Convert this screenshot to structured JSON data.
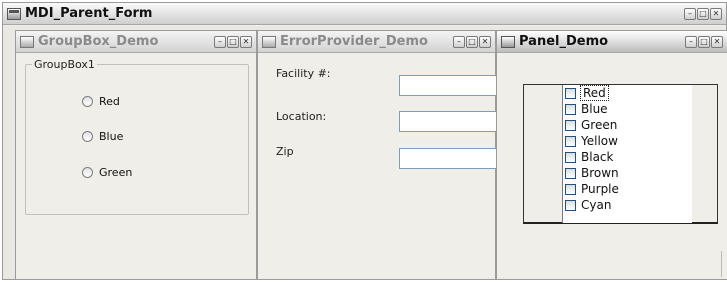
{
  "parent": {
    "title": "MDI_Parent_Form"
  },
  "windows": {
    "groupbox": {
      "title": "GroupBox_Demo",
      "group_label": "GroupBox1",
      "radios": [
        "Red",
        "Blue",
        "Green"
      ]
    },
    "errorprovider": {
      "title": "ErrorProvider_Demo",
      "fields": [
        {
          "label": "Facility #:",
          "value": ""
        },
        {
          "label": "Location:",
          "value": ""
        },
        {
          "label": "Zip",
          "value": ""
        }
      ]
    },
    "panel": {
      "title": "Panel_Demo",
      "items": [
        "Red",
        "Blue",
        "Green",
        "Yellow",
        "Black",
        "Brown",
        "Purple",
        "Cyan"
      ],
      "focused_item": "Red"
    }
  }
}
